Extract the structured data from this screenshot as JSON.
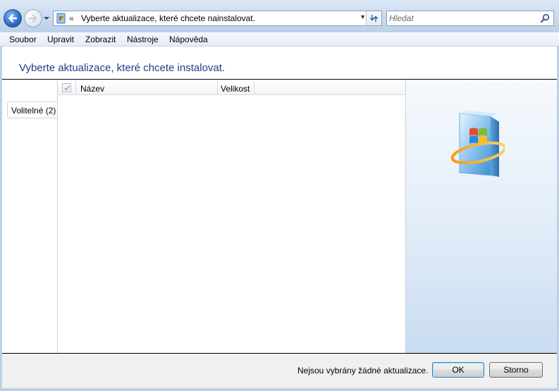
{
  "address_bar": {
    "overflow_chevron": "«",
    "path": "Vyberte aktualizace, které chcete nainstalovat."
  },
  "search": {
    "placeholder": "Hledat"
  },
  "menu": {
    "items": [
      "Soubor",
      "Upravit",
      "Zobrazit",
      "Nástroje",
      "Nápověda"
    ]
  },
  "page": {
    "title": "Vyberte aktualizace, které chcete instalovat."
  },
  "tabs": [
    {
      "label": "Volitelné (2)"
    }
  ],
  "list": {
    "columns": [
      "Název",
      "Velikost"
    ],
    "select_all_checked": true,
    "rows": []
  },
  "footer": {
    "status": "Nejsou vybrány žádné aktualizace.",
    "ok_label": "OK",
    "cancel_label": "Storno"
  },
  "icons": {
    "back": "back-arrow-icon",
    "forward": "forward-arrow-icon",
    "address": "windows-update-small-icon",
    "refresh": "refresh-icon",
    "search": "magnifier-icon",
    "logo": "windows-update-logo"
  },
  "colors": {
    "title": "#1e3d88",
    "ok_focus": "#3c7fb1"
  }
}
